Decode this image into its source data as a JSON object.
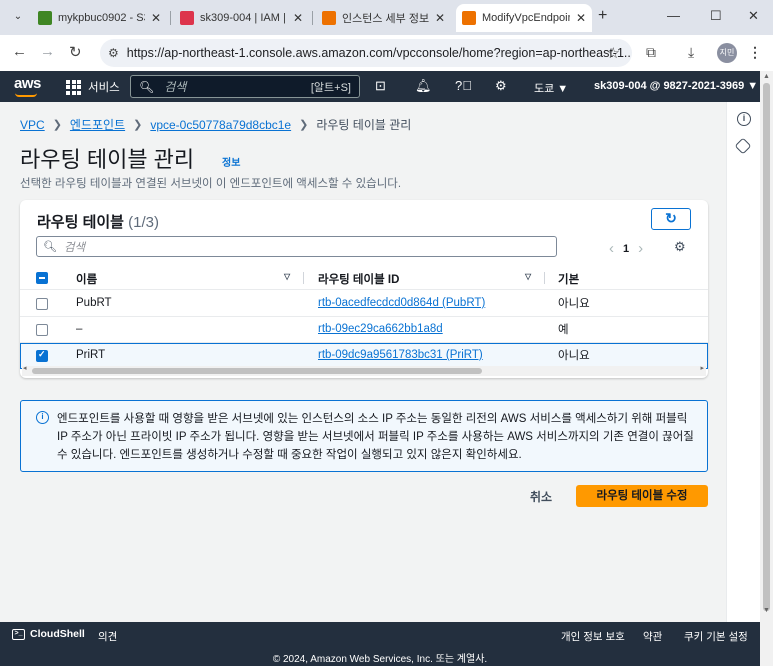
{
  "browser": {
    "tabs": [
      {
        "title": "mykpbuc0902 - S3",
        "favicon_color": "#3f8624"
      },
      {
        "title": "sk309-004 | IAM |",
        "favicon_color": "#dd344c"
      },
      {
        "title": "인스턴스 세부 정보",
        "favicon_color": "#ed7100"
      },
      {
        "title": "ModifyVpcEndpoint",
        "favicon_color": "#ed7100"
      }
    ],
    "url": "https://ap-northeast-1.console.aws.amazon.com/vpcconsole/home?region=ap-northeast-1...",
    "profile_label": "지민"
  },
  "aws_nav": {
    "logo": "aws",
    "services_label": "서비스",
    "search_placeholder": "검색",
    "search_shortcut": "[알트+S]",
    "region_label": "도쿄 ▼",
    "account_label": "sk309-004 @ 9827-2021-3969 ▼"
  },
  "breadcrumb": {
    "items": [
      "VPC",
      "엔드포인트",
      "vpce-0c50778a79d8cbc1e"
    ],
    "current": "라우팅 테이블 관리"
  },
  "page": {
    "title": "라우팅 테이블 관리",
    "info_label": "정보",
    "description": "선택한 라우팅 테이블과 연결된 서브넷이 이 엔드포인트에 액세스할 수 있습니다."
  },
  "route_tables": {
    "title": "라우팅 테이블",
    "count": "(1/3)",
    "search_placeholder": "검색",
    "page_number": "1",
    "columns": [
      "이름",
      "라우팅 테이블 ID",
      "기본"
    ],
    "rows": [
      {
        "name": "PubRT",
        "id": "rtb-0acedfecdcd0d864d (PubRT)",
        "default": "아니요",
        "checked": false
      },
      {
        "name": "–",
        "id": "rtb-09ec29ca662bb1a8d",
        "default": "예",
        "checked": false
      },
      {
        "name": "PriRT",
        "id": "rtb-09dc9a9561783bc31 (PriRT)",
        "default": "아니요",
        "checked": true
      }
    ]
  },
  "alert": {
    "text": "엔드포인트를 사용할 때 영향을 받은 서브넷에 있는 인스턴스의 소스 IP 주소는 동일한 리전의 AWS 서비스를 액세스하기 위해 퍼블릭 IP 주소가 아닌 프라이빗 IP 주소가 됩니다. 영향을 받는 서브넷에서 퍼블릭 IP 주소를 사용하는 AWS 서비스까지의 기존 연결이 끊어질 수 있습니다. 엔드포인트를 생성하거나 수정할 때 중요한 작업이 실행되고 있지 않은지 확인하세요."
  },
  "actions": {
    "cancel": "취소",
    "submit": "라우팅 테이블 수정"
  },
  "footer": {
    "cloudshell": "CloudShell",
    "feedback": "의견",
    "privacy": "개인 정보 보호",
    "terms": "약관",
    "cookies": "쿠키 기본 설정",
    "copyright": "© 2024, Amazon Web Services, Inc. 또는 계열사."
  },
  "colors": {
    "aws_nav_bg": "#232f3e",
    "link_blue": "#0972d3",
    "primary_orange": "#ff9900"
  }
}
